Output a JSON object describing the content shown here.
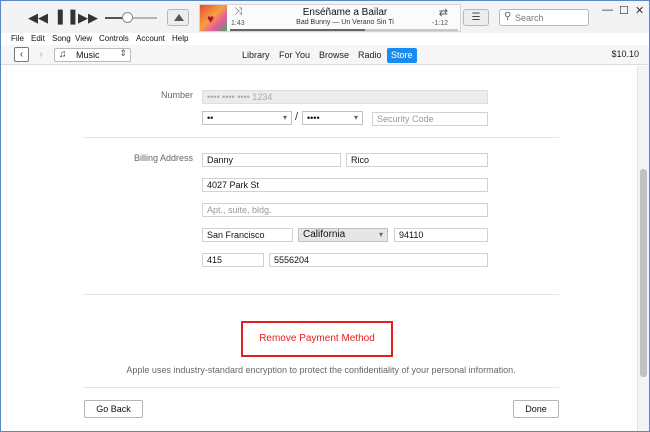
{
  "player": {
    "rewind_icon": "rewind-icon",
    "pause_icon": "pause-icon",
    "forward_icon": "fast-forward-icon",
    "song_title": "Enséñame a Bailar",
    "song_artist": "Bad Bunny — Un Verano Sin Ti",
    "time_elapsed": "1:43",
    "time_remaining": "-1:12",
    "volume": 0.45,
    "progress": 0.59
  },
  "search": {
    "placeholder": "Search"
  },
  "menu": {
    "items": [
      "File",
      "Edit",
      "Song",
      "View",
      "Controls",
      "Account",
      "Help"
    ]
  },
  "nav": {
    "media_type": "Music",
    "tabs": [
      "Library",
      "For You",
      "Browse",
      "Radio",
      "Store"
    ],
    "active_tab": "Store",
    "balance": "$10.10"
  },
  "form": {
    "number_label": "Number",
    "card_number": "•••• •••• •••• 1234",
    "exp_month": "••",
    "exp_year": "••••",
    "exp_separator": "/",
    "security_placeholder": "Security Code",
    "billing_label": "Billing Address",
    "first_name": "Danny",
    "last_name": "Rico",
    "street": "4027 Park St",
    "apt_placeholder": "Apt., suite, bldg.",
    "city": "San Francisco",
    "state": "California",
    "zip": "94110",
    "area_code": "415",
    "phone": "5556204"
  },
  "remove_label": "Remove Payment Method",
  "info_text": "Apple uses industry-standard encryption to protect the confidentiality of your personal information.",
  "buttons": {
    "back": "Go Back",
    "done": "Done"
  }
}
